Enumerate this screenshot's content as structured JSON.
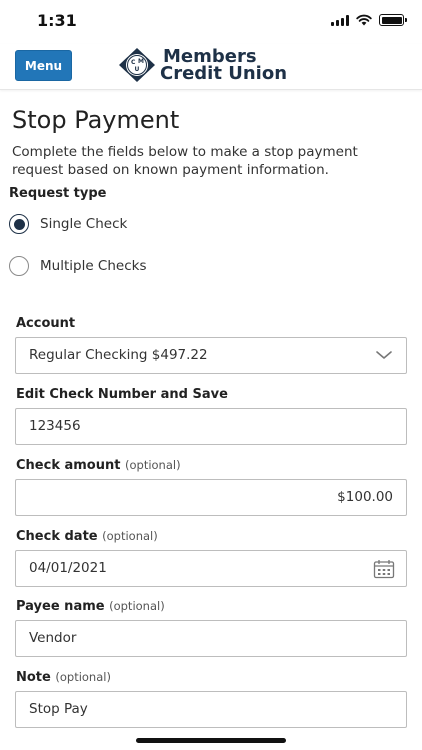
{
  "status_bar": {
    "time": "1:31"
  },
  "header": {
    "menu_label": "Menu",
    "logo_line1": "Members",
    "logo_line2": "Credit Union",
    "logo_monogram": "CMU",
    "brand_color": "#1e3147",
    "button_color": "#2276b8"
  },
  "page": {
    "title": "Stop Payment",
    "description": "Complete the fields below to make a stop payment request based on known payment information."
  },
  "request_type": {
    "label": "Request type",
    "options": [
      {
        "label": "Single Check",
        "selected": true
      },
      {
        "label": "Multiple Checks",
        "selected": false
      }
    ]
  },
  "form": {
    "account": {
      "label": "Account",
      "value": "Regular Checking $497.22"
    },
    "check_number": {
      "label": "Edit Check Number and Save",
      "value": "123456"
    },
    "check_amount": {
      "label": "Check amount",
      "optional": "(optional)",
      "value": "$100.00"
    },
    "check_date": {
      "label": "Check date",
      "optional": "(optional)",
      "value": "04/01/2021"
    },
    "payee_name": {
      "label": "Payee name",
      "optional": "(optional)",
      "value": "Vendor"
    },
    "note": {
      "label": "Note",
      "optional": "(optional)",
      "value": "Stop Pay"
    }
  }
}
